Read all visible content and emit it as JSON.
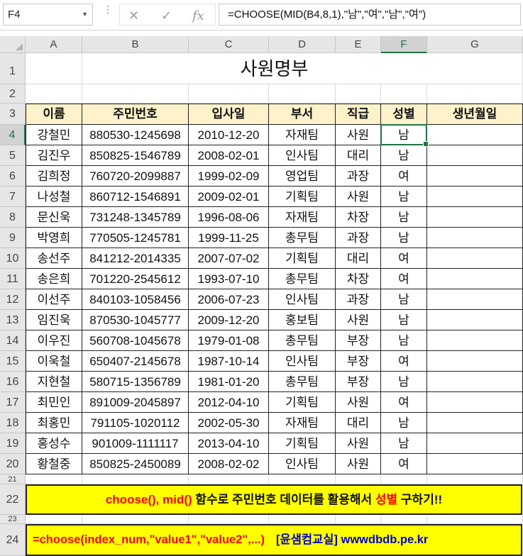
{
  "formula_bar": {
    "name_box": "F4",
    "cancel_icon": "✕",
    "confirm_icon": "✓",
    "fx_label": "fx",
    "formula": "=CHOOSE(MID(B4,8,1),\"남\",\"여\",\"남\",\"여\")"
  },
  "columns": [
    "A",
    "B",
    "C",
    "D",
    "E",
    "F",
    "G"
  ],
  "rows": [
    "1",
    "2",
    "3",
    "4",
    "5",
    "6",
    "7",
    "8",
    "9",
    "10",
    "11",
    "12",
    "13",
    "14",
    "15",
    "16",
    "17",
    "18",
    "19",
    "20",
    "21",
    "22",
    "23",
    "24"
  ],
  "sheet": {
    "title": "사원명부",
    "headers": [
      "이름",
      "주민번호",
      "입사일",
      "부서",
      "직급",
      "성별",
      "생년월일"
    ],
    "records": [
      [
        "강철민",
        "880530-1245698",
        "2010-12-20",
        "자재팀",
        "사원",
        "남",
        ""
      ],
      [
        "김진우",
        "850825-1546789",
        "2008-02-01",
        "인사팀",
        "대리",
        "남",
        ""
      ],
      [
        "김희정",
        "760720-2099887",
        "1999-02-09",
        "영업팀",
        "과장",
        "여",
        ""
      ],
      [
        "나성철",
        "860712-1546891",
        "2009-02-01",
        "기획팀",
        "사원",
        "남",
        ""
      ],
      [
        "문신욱",
        "731248-1345789",
        "1996-08-06",
        "자재팀",
        "차장",
        "남",
        ""
      ],
      [
        "박영희",
        "770505-1245781",
        "1999-11-25",
        "총무팀",
        "과장",
        "남",
        ""
      ],
      [
        "송선주",
        "841212-2014335",
        "2007-07-02",
        "기획팀",
        "대리",
        "여",
        ""
      ],
      [
        "송은희",
        "701220-2545612",
        "1993-07-10",
        "총무팀",
        "차장",
        "여",
        ""
      ],
      [
        "이선주",
        "840103-1058456",
        "2006-07-23",
        "인사팀",
        "과장",
        "남",
        ""
      ],
      [
        "임진욱",
        "870530-1045777",
        "2009-12-20",
        "홍보팀",
        "사원",
        "남",
        ""
      ],
      [
        "이우진",
        "560708-1045678",
        "1979-01-08",
        "총무팀",
        "부장",
        "남",
        ""
      ],
      [
        "이욱철",
        "650407-2145678",
        "1987-10-14",
        "인사팀",
        "부장",
        "여",
        ""
      ],
      [
        "지현철",
        "580715-1356789",
        "1981-01-20",
        "총무팀",
        "부장",
        "남",
        ""
      ],
      [
        "최민인",
        "891009-2045897",
        "2012-04-10",
        "기획팀",
        "사원",
        "여",
        ""
      ],
      [
        "최홍민",
        "791105-1020112",
        "2002-05-30",
        "자재팀",
        "대리",
        "남",
        ""
      ],
      [
        "홍성수",
        "901009-1111117",
        "2013-04-10",
        "기획팀",
        "사원",
        "남",
        ""
      ],
      [
        "황철중",
        "850825-2450089",
        "2008-02-02",
        "인사팀",
        "사원",
        "여",
        ""
      ]
    ]
  },
  "banner22": {
    "part1": "choose(), mid() ",
    "part2": "함수로 주민번호 데이터를 활용해서 ",
    "part3": "성별",
    "part4": " 구하기!!"
  },
  "banner24": {
    "part1": "=choose(index_num,\"value1\",\"value2\",...)",
    "part2": "[윤샘컴교실] wwwdbdb.pe.kr"
  },
  "colors": {
    "header_fill": "#fef2cb",
    "banner_fill": "#ffff00",
    "banner_red": "#ff0000",
    "banner_blue": "#0000cc",
    "selection": "#217346"
  }
}
